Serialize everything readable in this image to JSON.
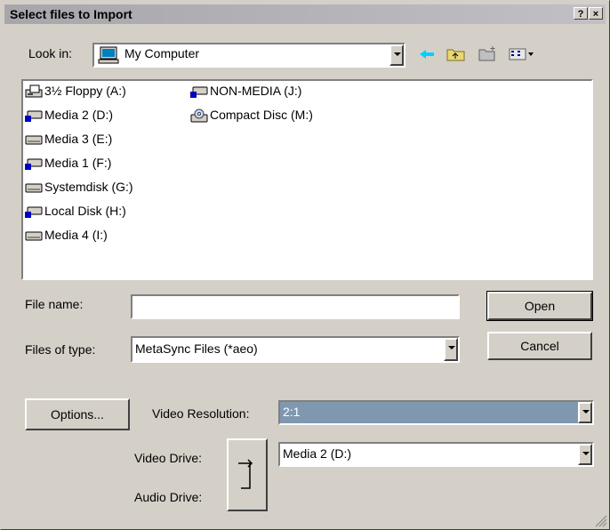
{
  "window": {
    "title": "Select files to Import",
    "help_glyph": "?",
    "close_glyph": "×"
  },
  "lookin": {
    "label": "Look in:",
    "value": "My Computer"
  },
  "toolbar": {
    "icons": [
      "back-arrow-icon",
      "up-folder-icon",
      "new-folder-icon",
      "view-menu-icon"
    ]
  },
  "files": [
    {
      "label": "3½ Floppy (A:)",
      "icon": "floppy-drive-icon"
    },
    {
      "label": "Media 2 (D:)",
      "icon": "network-drive-icon"
    },
    {
      "label": "Media 3 (E:)",
      "icon": "hard-drive-icon"
    },
    {
      "label": "Media 1 (F:)",
      "icon": "network-drive-icon"
    },
    {
      "label": "Systemdisk (G:)",
      "icon": "hard-drive-icon"
    },
    {
      "label": "Local Disk (H:)",
      "icon": "network-drive-icon"
    },
    {
      "label": "Media 4 (I:)",
      "icon": "hard-drive-icon"
    },
    {
      "label": "NON-MEDIA (J:)",
      "icon": "network-drive-icon"
    },
    {
      "label": "Compact Disc (M:)",
      "icon": "cd-drive-icon"
    }
  ],
  "filename": {
    "label": "File name:",
    "value": ""
  },
  "filetype": {
    "label": "Files of type:",
    "value": "MetaSync Files (*aeo)"
  },
  "buttons": {
    "open": "Open",
    "cancel": "Cancel",
    "options": "Options..."
  },
  "video_resolution": {
    "label": "Video Resolution:",
    "value": "2:1"
  },
  "video_drive": {
    "label": "Video Drive:",
    "value": "Media 2 (D:)"
  },
  "audio_drive": {
    "label": "Audio Drive:"
  },
  "colors": {
    "title_bar": "#a7a6aa",
    "face": "#d4d0c8",
    "selection": "#7f98b0"
  }
}
